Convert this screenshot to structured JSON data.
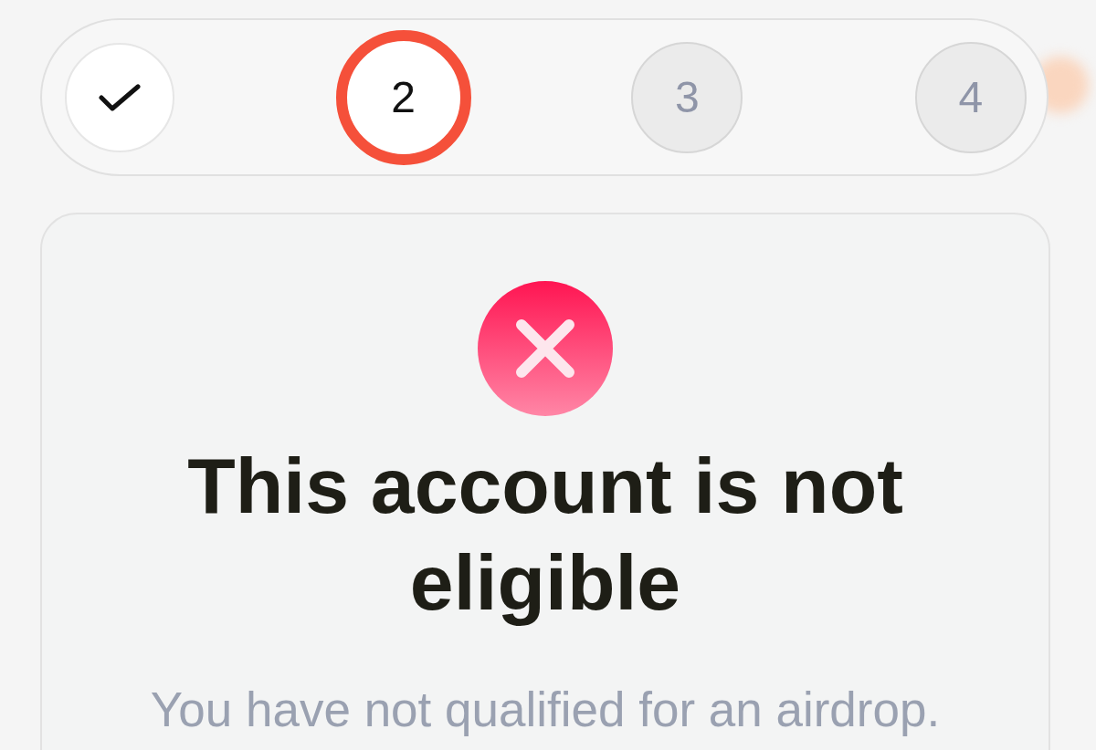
{
  "stepper": {
    "steps": [
      {
        "completed": true,
        "selected": false
      },
      {
        "label": "2",
        "completed": false,
        "selected": true
      },
      {
        "label": "3",
        "completed": false,
        "selected": false
      },
      {
        "label": "4",
        "completed": false,
        "selected": false
      }
    ]
  },
  "result": {
    "kind": "error",
    "title": "This account is not eligible",
    "message": "You have not qualified for an airdrop."
  }
}
